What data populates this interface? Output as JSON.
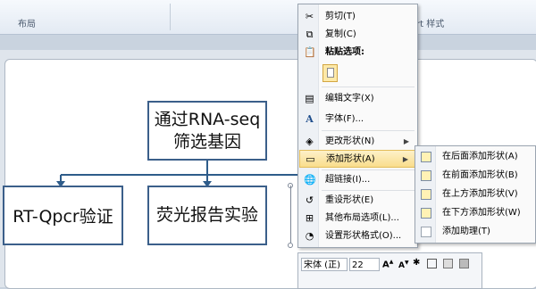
{
  "ribbon": {
    "group_layout": "布局",
    "group_style": "rt 样式"
  },
  "nodes": {
    "root": "通过RNA-seq筛选基因",
    "child1": "RT-Qpcr验证",
    "child2": "荧光报告实验"
  },
  "context_menu": {
    "items": [
      {
        "label": "剪切(T)",
        "icon": "✂"
      },
      {
        "label": "复制(C)",
        "icon": "⧉"
      },
      {
        "label": "粘贴选项:",
        "icon": "📋"
      },
      {
        "label": "编辑文字(X)",
        "icon": "▤"
      },
      {
        "label": "字体(F)...",
        "icon": "A"
      },
      {
        "label": "更改形状(N)",
        "icon": "◈"
      },
      {
        "label": "添加形状(A)",
        "icon": "▭"
      },
      {
        "label": "超链接(I)...",
        "icon": "🌐"
      },
      {
        "label": "重设形状(E)",
        "icon": "↺"
      },
      {
        "label": "其他布局选项(L)...",
        "icon": "⊞"
      },
      {
        "label": "设置形状格式(O)...",
        "icon": "◔"
      }
    ]
  },
  "submenu": {
    "items": [
      {
        "label": "在后面添加形状(A)"
      },
      {
        "label": "在前面添加形状(B)"
      },
      {
        "label": "在上方添加形状(V)"
      },
      {
        "label": "在下方添加形状(W)"
      },
      {
        "label": "添加助理(T)"
      }
    ]
  },
  "mini_toolbar": {
    "font": "宋体 (正)",
    "size": "22"
  }
}
